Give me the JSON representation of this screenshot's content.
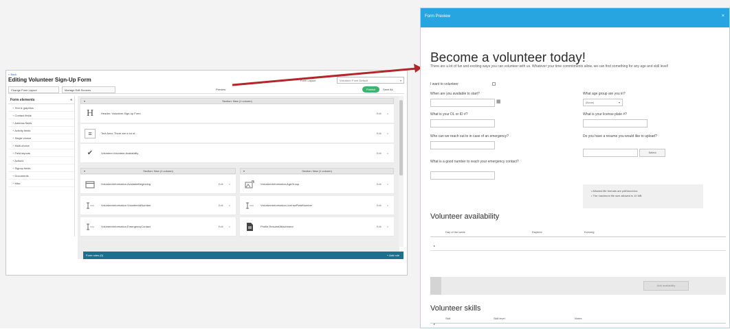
{
  "builder": {
    "back_link": "< Back",
    "title": "Editing Volunteer Sign-Up Form",
    "language_label": "Form Layout",
    "language_value": "Volunteer Form Default",
    "toolbar": {
      "change_form_layout": "Change Form Layout",
      "manage_edit_sources": "Manage Edit Sources",
      "preview": "Preview",
      "publish": "Publish",
      "save": "Save As"
    },
    "sidebar": {
      "header": "Form elements",
      "items": [
        "Text & graphics",
        "Contact fields",
        "Address fields",
        "Activity fields",
        "Single choice",
        "Multi-choice",
        "Field layouts",
        "Actions",
        "Signup fields",
        "Documents",
        "Misc"
      ]
    },
    "sections": {
      "section1": "Section: New (1 column)",
      "section2": "Section: New (1 column)",
      "section3": "Section: New (1 column)"
    },
    "rows_single": [
      {
        "icon": "H",
        "label": "Header: Volunteer Sign-up Form"
      },
      {
        "icon": "≡",
        "label": "Text Area: There are a lot of..."
      },
      {
        "icon": "✔",
        "label": "Volunteer.Volunteer.Availability"
      }
    ],
    "rows_left": [
      {
        "label": "VolunteerInformation.AvailableBeginning"
      },
      {
        "label": "VolunteerInformation.VolunteerIdNumber"
      },
      {
        "label": "VolunteerInformation.EmergencyContact"
      }
    ],
    "rows_right": [
      {
        "label": "VolunteerInformation.AgeGroup"
      },
      {
        "label": "VolunteerInformation.LicensePlateNumber"
      },
      {
        "label": "Profile.ResumeAttachment"
      }
    ],
    "row_action": "Edit",
    "row_delete": "×",
    "footer": {
      "label": "Form rules (0)",
      "add": "+ Add rule"
    }
  },
  "preview": {
    "title": "Form Preview",
    "close": "×",
    "heading": "Become a volunteer today!",
    "intro": "There are a lot of fun and exciting ways you can volunteer with us. Whatever your time commitments allow, we can find something for any age and skill level!",
    "want_to_volunteer": "I want to volunteer",
    "q_available": "When are you available to start?",
    "q_age_group": "What age group are you in?",
    "age_group_value": "(None)",
    "q_dl": "What is your DL or ID #?",
    "q_license_plate": "What is your license plate #?",
    "q_emergency": "Who can we reach out to in case of an emergency?",
    "q_resume": "Do you have a resume you would like to upload?",
    "q_emergency_phone": "What is a good number to reach your emergency contact?",
    "select_button": "Select",
    "info_lines": [
      "Allowed file formats are pdf/docx/doc",
      "The maximum file size allowed is 10 MB"
    ],
    "availability_heading": "Volunteer availability",
    "availability_cols": [
      "Day of the week",
      "Daytime",
      "Evening"
    ],
    "add_availability": "Add availability",
    "skills_heading": "Volunteer skills",
    "skills_cols": [
      "Skill",
      "Skill level",
      "Notes"
    ],
    "row_marker": "▸"
  },
  "colors": {
    "accent": "#27a5e0",
    "footer_bar": "#1d6f8e",
    "publish": "#3cb371",
    "arrow": "#b3262b"
  }
}
